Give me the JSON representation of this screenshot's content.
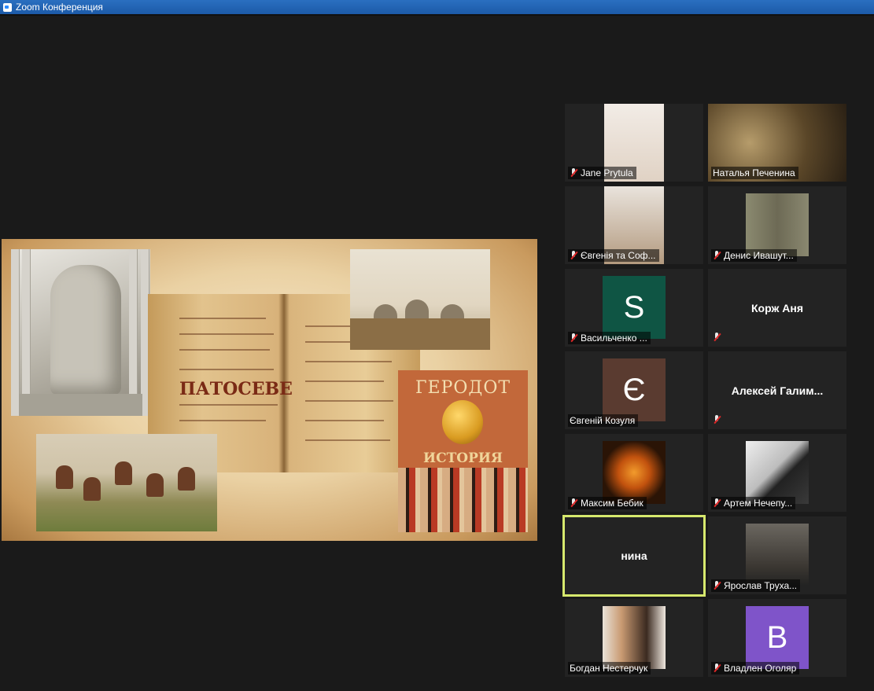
{
  "window": {
    "title": "Zoom Конференция"
  },
  "slide": {
    "book_title": "ГЕРОДОТ",
    "book_subtitle": "ИСТОРИЯ",
    "manuscript_text": "ПАТОСЕВЕ"
  },
  "participants": [
    {
      "name": "Jane Prytula",
      "muted": true,
      "type": "video",
      "bg": "#e7ddd3"
    },
    {
      "name": "Наталья Печенина",
      "muted": false,
      "type": "video-wide",
      "bg": "#6e5a3a"
    },
    {
      "name": "Євгенія та Соф...",
      "muted": true,
      "type": "video",
      "bg": "#c9b59a"
    },
    {
      "name": "Денис Ивашут...",
      "muted": true,
      "type": "video",
      "bg": "#75725d"
    },
    {
      "name": "Васильченко ...",
      "muted": true,
      "type": "avatar",
      "letter": "S",
      "avatar_color": "#0f5544"
    },
    {
      "name": "Корж Аня",
      "muted": true,
      "type": "name-only"
    },
    {
      "name": "Євгеній Козуля",
      "muted": false,
      "type": "avatar",
      "letter": "Є",
      "avatar_color": "#5a3b30"
    },
    {
      "name": "Алексей  Галим...",
      "muted": true,
      "type": "name-only"
    },
    {
      "name": "Максим Бебик",
      "muted": true,
      "type": "video",
      "bg": "#2a1406"
    },
    {
      "name": "Артем Нечепу...",
      "muted": true,
      "type": "video",
      "bg": "#d5d5d5"
    },
    {
      "name": "нина",
      "muted": false,
      "type": "name-only",
      "active": true
    },
    {
      "name": "Ярослав Труха...",
      "muted": true,
      "type": "video",
      "bg": "#4a4640"
    },
    {
      "name": "Богдан Нестерчук",
      "muted": false,
      "type": "video",
      "bg": "#c7a98d"
    },
    {
      "name": "Владлен Оголяр",
      "muted": true,
      "type": "avatar",
      "letter": "B",
      "avatar_color": "#7f54c9"
    }
  ]
}
